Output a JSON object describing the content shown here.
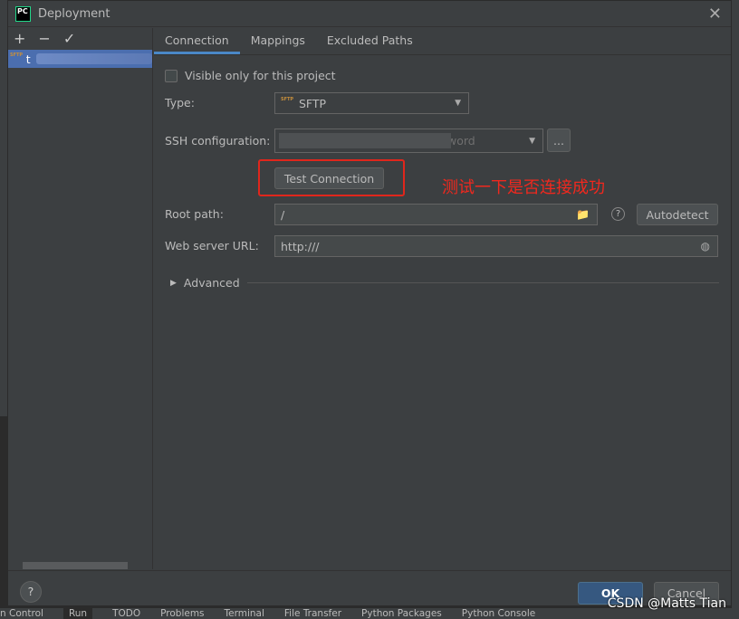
{
  "window": {
    "title": "Deployment",
    "logo": "PC"
  },
  "left_toolbar": {
    "add": "+",
    "remove": "−",
    "apply": "✓"
  },
  "server_list": [
    {
      "name": "t",
      "type_icon": "SFTP",
      "selected": true
    }
  ],
  "tabs": [
    {
      "label": "Connection",
      "active": true
    },
    {
      "label": "Mappings"
    },
    {
      "label": "Excluded Paths"
    }
  ],
  "form": {
    "visible_only": {
      "label": "Visible only for this project",
      "checked": false
    },
    "type": {
      "label": "Type:",
      "value": "SFTP"
    },
    "ssh": {
      "label": "SSH configuration:",
      "value": "word",
      "more": "..."
    },
    "test_connection": "Test Connection",
    "annotation": "测试一下是否连接成功",
    "root_path": {
      "label": "Root path:",
      "value": "/",
      "autodetect": "Autodetect"
    },
    "web_url": {
      "label": "Web server URL:",
      "value": "http:///"
    },
    "advanced": "Advanced"
  },
  "footer": {
    "help": "?",
    "ok": "OK",
    "cancel": "Cancel"
  },
  "statusbar": [
    "n Control",
    "Run",
    "TODO",
    "Problems",
    "Terminal",
    "File Transfer",
    "Python Packages",
    "Python Console"
  ],
  "watermark": "CSDN @Matts Tian",
  "colors": {
    "accent": "#4a88c7",
    "ok": "#365880",
    "annotation": "#f0281e"
  }
}
